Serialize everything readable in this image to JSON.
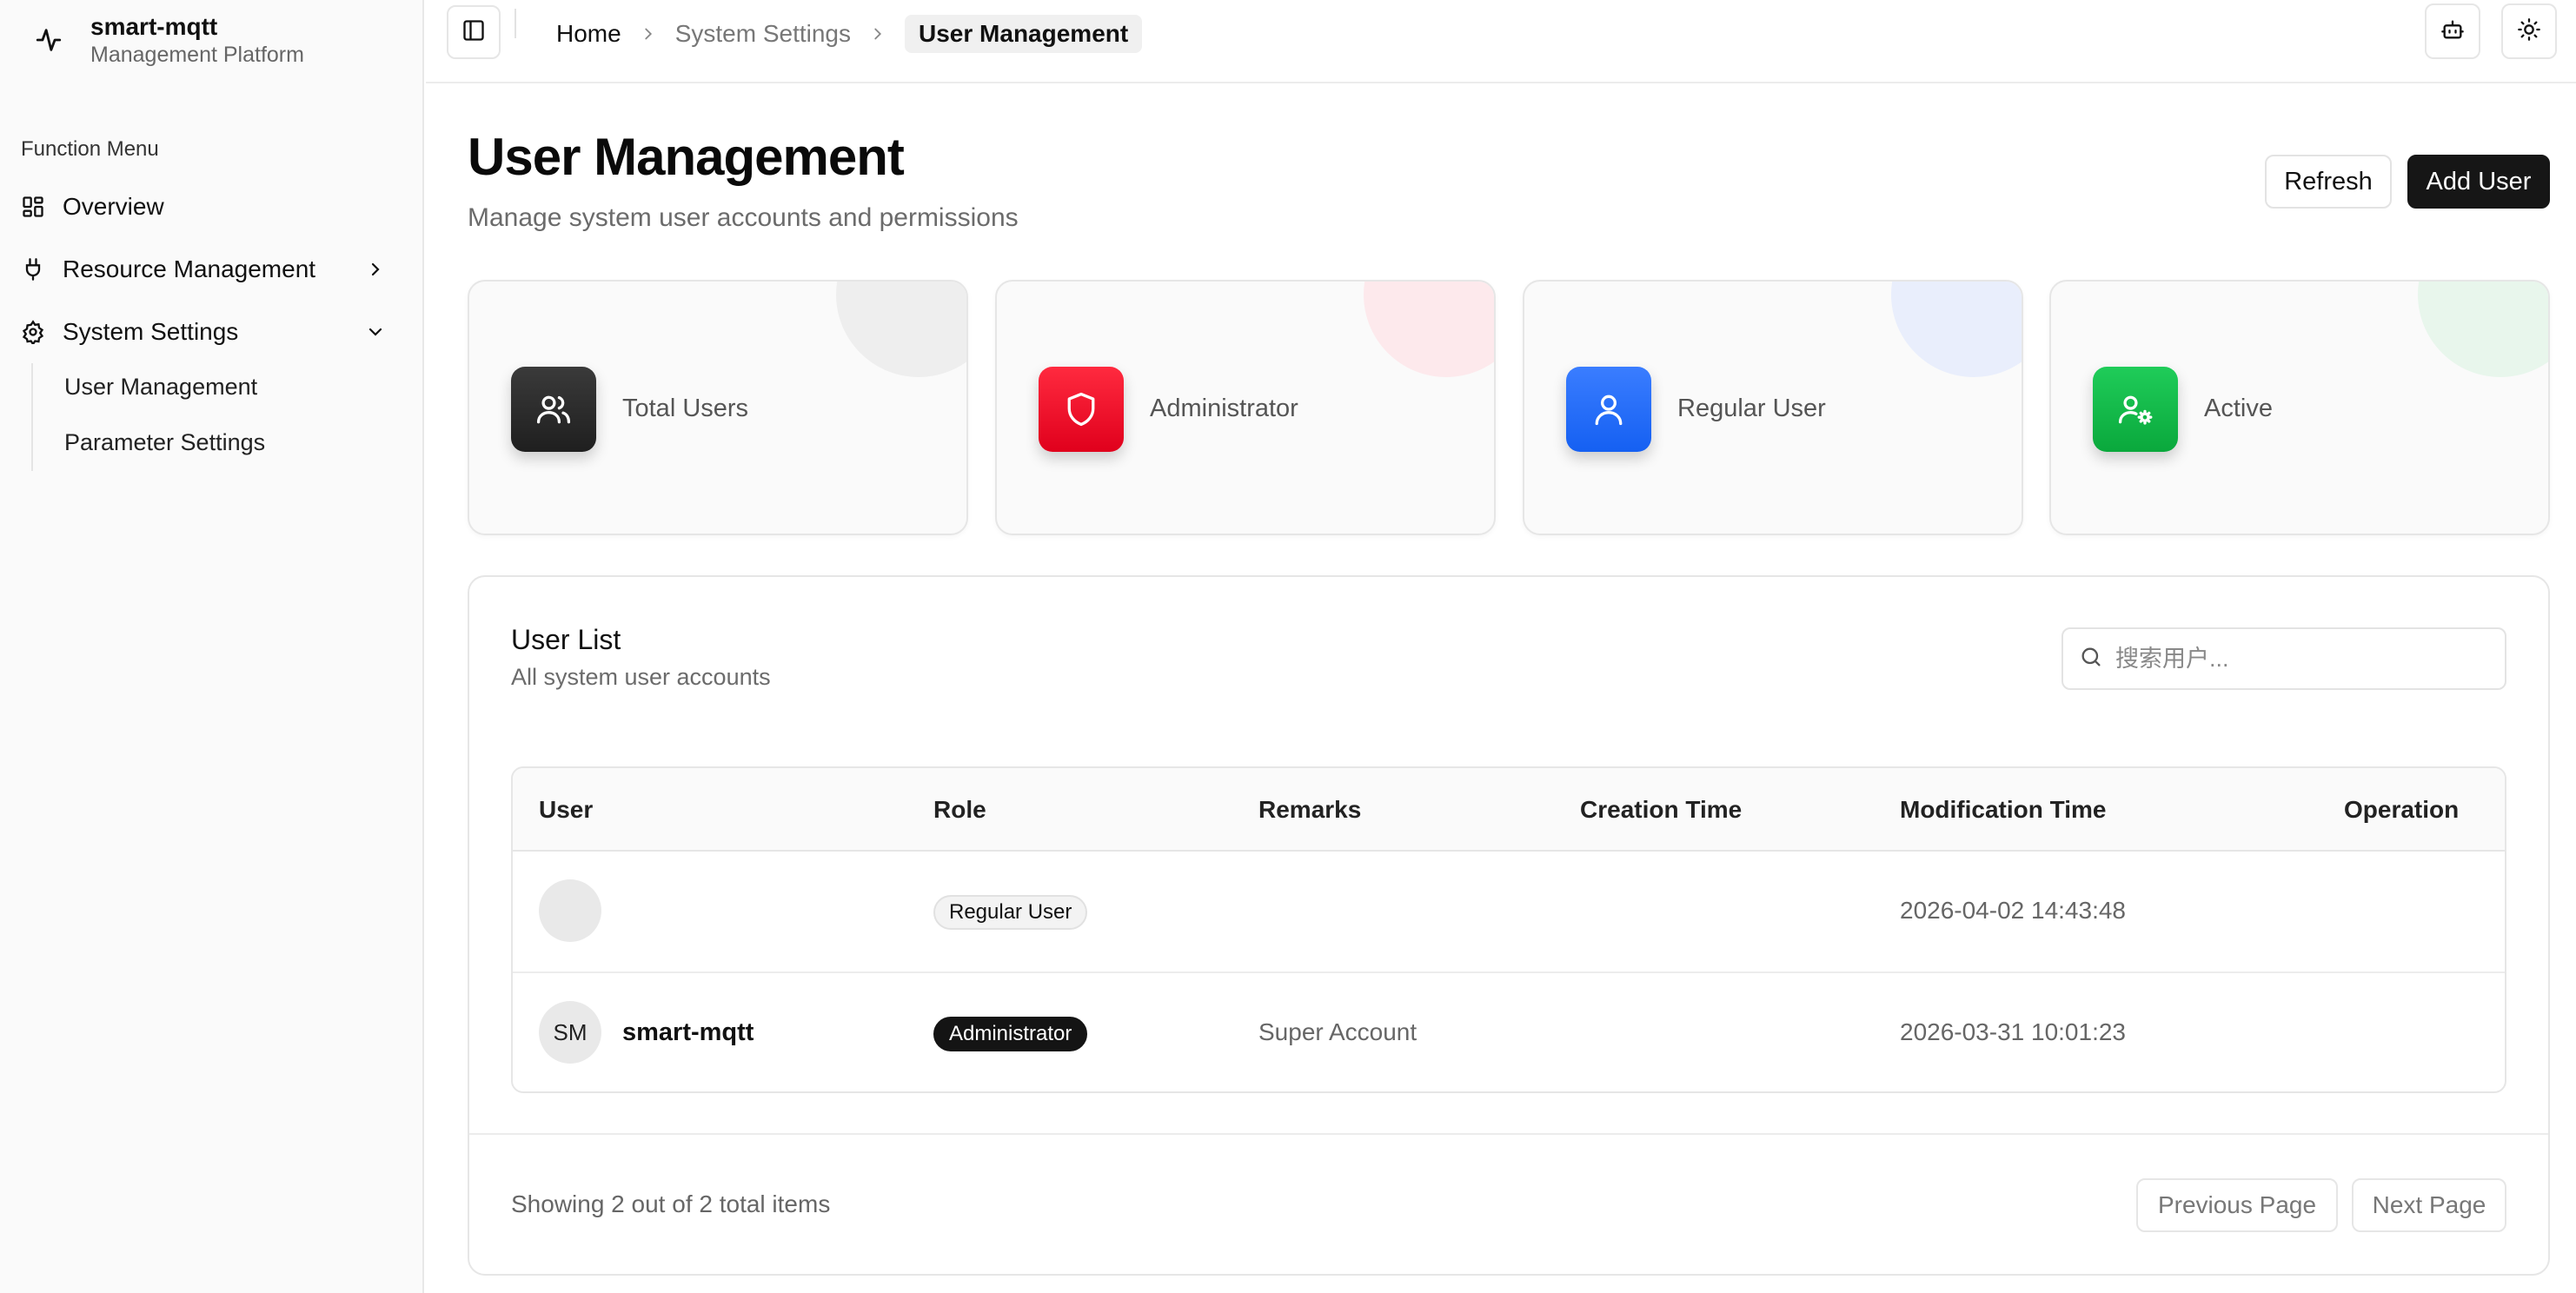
{
  "brand": {
    "title": "smart-mqtt",
    "subtitle": "Management Platform",
    "icon": "activity-icon"
  },
  "sidebar": {
    "menu_title": "Function Menu",
    "items": [
      {
        "label": "Overview",
        "icon": "dashboard-icon"
      },
      {
        "label": "Resource Management",
        "icon": "plug-icon",
        "chevron": "chevron-right-icon"
      },
      {
        "label": "System Settings",
        "icon": "gear-icon",
        "chevron": "chevron-down-icon"
      }
    ],
    "subitems": [
      {
        "label": "User Management"
      },
      {
        "label": "Parameter Settings"
      }
    ]
  },
  "topbar": {
    "breadcrumb": [
      "Home",
      "System Settings",
      "User Management"
    ],
    "icons": [
      "sidebar-toggle-icon",
      "bot-icon",
      "sun-icon"
    ]
  },
  "page": {
    "title": "User Management",
    "subtitle": "Manage system user accounts and permissions",
    "refresh_label": "Refresh",
    "add_label": "Add User"
  },
  "stats": [
    {
      "label": "Total Users",
      "icon": "users-icon",
      "color": "#2a2a2a"
    },
    {
      "label": "Administrator",
      "icon": "shield-icon",
      "color": "#f0102c"
    },
    {
      "label": "Regular User",
      "icon": "user-icon",
      "color": "#1f6bff"
    },
    {
      "label": "Active",
      "icon": "user-gear-icon",
      "color": "#12b548"
    }
  ],
  "list": {
    "title": "User List",
    "subtitle": "All system user accounts",
    "search_placeholder": "搜索用户...",
    "columns": [
      "User",
      "Role",
      "Remarks",
      "Creation Time",
      "Modification Time",
      "Operation"
    ],
    "rows": [
      {
        "initials": "",
        "name": "",
        "role": "Regular User",
        "role_style": "light",
        "remarks": "",
        "created": "",
        "modified": "2026-04-02 14:43:48"
      },
      {
        "initials": "SM",
        "name": "smart-mqtt",
        "role": "Administrator",
        "role_style": "dark",
        "remarks": "Super Account",
        "created": "",
        "modified": "2026-03-31 10:01:23"
      }
    ],
    "footer": "Showing 2 out of 2 total items",
    "prev_label": "Previous Page",
    "next_label": "Next Page"
  }
}
